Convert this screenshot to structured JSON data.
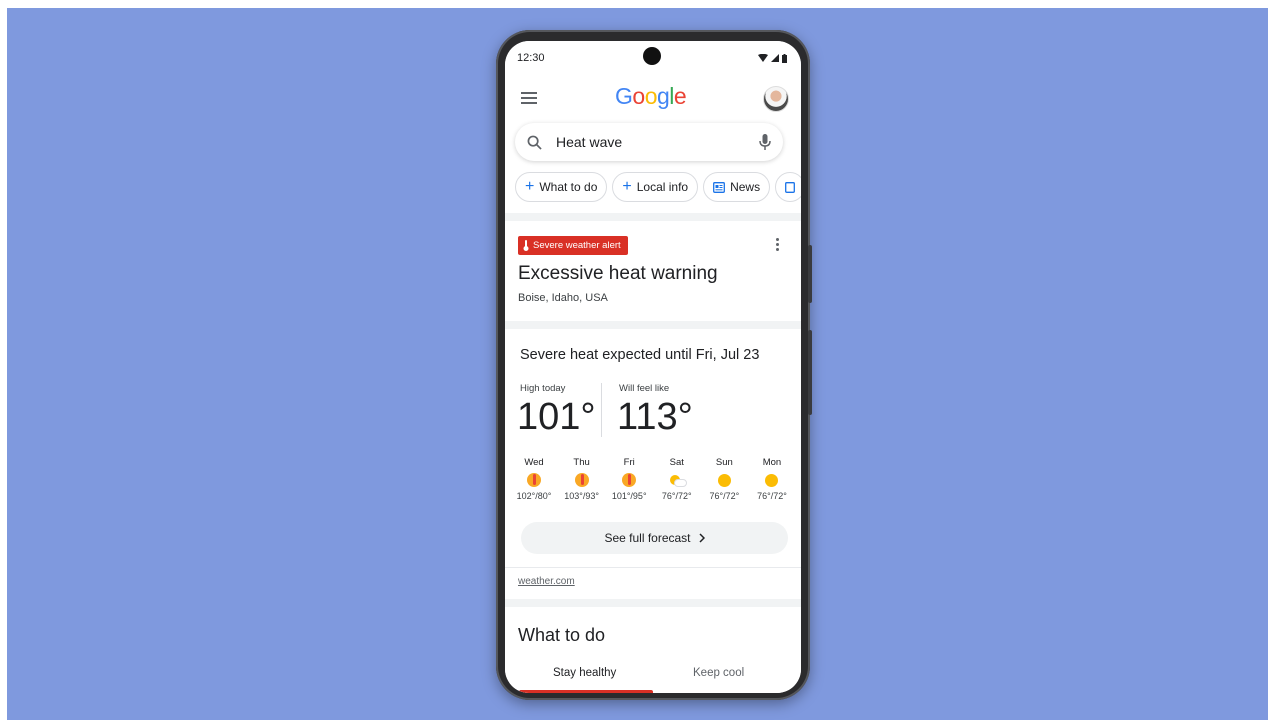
{
  "status_bar": {
    "time": "12:30"
  },
  "header": {
    "logo_letters": [
      "G",
      "o",
      "o",
      "g",
      "l",
      "e"
    ],
    "logo_colors": [
      "#4285F4",
      "#EA4335",
      "#FBBC05",
      "#4285F4",
      "#34A853",
      "#EA4335"
    ]
  },
  "search": {
    "query": "Heat wave"
  },
  "chips": [
    {
      "label": "What to do",
      "icon": "plus-icon"
    },
    {
      "label": "Local info",
      "icon": "plus-icon"
    },
    {
      "label": "News",
      "icon": "news-icon"
    }
  ],
  "alert": {
    "badge": "Severe weather alert",
    "title": "Excessive heat warning",
    "location": "Boise, Idaho, USA"
  },
  "weather": {
    "headline": "Severe heat expected until Fri, Jul 23",
    "high_label": "High today",
    "high_value": "101°",
    "feel_label": "Will feel like",
    "feel_value": "113°",
    "days": [
      {
        "name": "Wed",
        "temps": "102°/80°",
        "icon": "hot-icon"
      },
      {
        "name": "Thu",
        "temps": "103°/93°",
        "icon": "hot-icon"
      },
      {
        "name": "Fri",
        "temps": "101°/95°",
        "icon": "hot-icon"
      },
      {
        "name": "Sat",
        "temps": "76°/72°",
        "icon": "partly-sunny-icon"
      },
      {
        "name": "Sun",
        "temps": "76°/72°",
        "icon": "sunny-icon"
      },
      {
        "name": "Mon",
        "temps": "76°/72°",
        "icon": "sunny-icon"
      }
    ],
    "forecast_button": "See full forecast",
    "source": "weather.com"
  },
  "what_to_do": {
    "title": "What to do",
    "tabs": [
      "Stay healthy",
      "Keep cool"
    ]
  },
  "colors": {
    "background": "#7f99de",
    "alert_red": "#d93025",
    "accent_blue": "#1a73e8"
  }
}
